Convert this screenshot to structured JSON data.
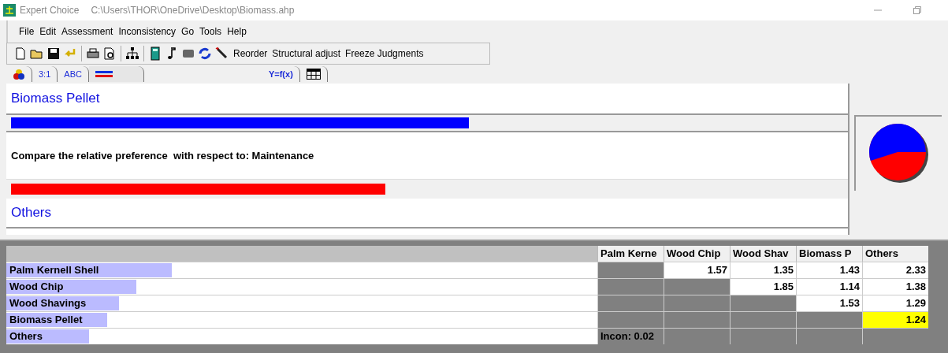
{
  "window": {
    "app": "Expert Choice",
    "path": "C:\\Users\\THOR\\OneDrive\\Desktop\\Biomass.ahp"
  },
  "menu": [
    "File",
    "Edit",
    "Assessment",
    "Inconsistency",
    "Go",
    "Tools",
    "Help"
  ],
  "toolbar": {
    "text_buttons": [
      "Reorder",
      "Structural adjust",
      "Freeze Judgments"
    ]
  },
  "tabs": [
    {
      "kind": "cubes",
      "selected": false
    },
    {
      "kind": "text",
      "label": "3:1",
      "selected": false
    },
    {
      "kind": "text",
      "label": "ABC",
      "selected": false
    },
    {
      "kind": "bars",
      "selected": true
    },
    {
      "kind": "text",
      "label": "Y=f(x)",
      "selected": false
    },
    {
      "kind": "grid",
      "selected": false
    }
  ],
  "comparison": {
    "top": {
      "name": "Biomass Pellet",
      "level": 0.55
    },
    "question": "Compare the relative preference  with respect to: Maintenance",
    "bottom": {
      "name": "Others",
      "level": 0.45
    }
  },
  "matrix": {
    "columns": [
      "Palm Kerne",
      "Wood Chip",
      "Wood Shav",
      "Biomass P",
      "Others"
    ],
    "rows": [
      {
        "label": "Palm Kernell Shell",
        "level": 0.28,
        "cells": [
          {
            "kind": "gray"
          },
          {
            "kind": "value",
            "text": "1.57"
          },
          {
            "kind": "value",
            "text": "1.35"
          },
          {
            "kind": "value",
            "text": "1.43"
          },
          {
            "kind": "value",
            "text": "2.33"
          }
        ]
      },
      {
        "label": "Wood Chip",
        "level": 0.22,
        "cells": [
          {
            "kind": "gray"
          },
          {
            "kind": "gray"
          },
          {
            "kind": "value",
            "text": "1.85"
          },
          {
            "kind": "value",
            "text": "1.14"
          },
          {
            "kind": "value",
            "text": "1.38"
          }
        ]
      },
      {
        "label": "Wood Shavings",
        "level": 0.19,
        "cells": [
          {
            "kind": "gray"
          },
          {
            "kind": "gray"
          },
          {
            "kind": "gray"
          },
          {
            "kind": "value",
            "text": "1.53"
          },
          {
            "kind": "value",
            "text": "1.29"
          }
        ]
      },
      {
        "label": "Biomass Pellet",
        "level": 0.17,
        "cells": [
          {
            "kind": "gray"
          },
          {
            "kind": "gray"
          },
          {
            "kind": "gray"
          },
          {
            "kind": "gray"
          },
          {
            "kind": "highlight",
            "text": "1.24"
          }
        ]
      },
      {
        "label": "Others",
        "level": 0.14,
        "cells": [
          {
            "kind": "gray",
            "text": "Incon: 0.02"
          },
          {
            "kind": "gray"
          },
          {
            "kind": "gray"
          },
          {
            "kind": "gray"
          },
          {
            "kind": "gray"
          }
        ]
      }
    ]
  }
}
